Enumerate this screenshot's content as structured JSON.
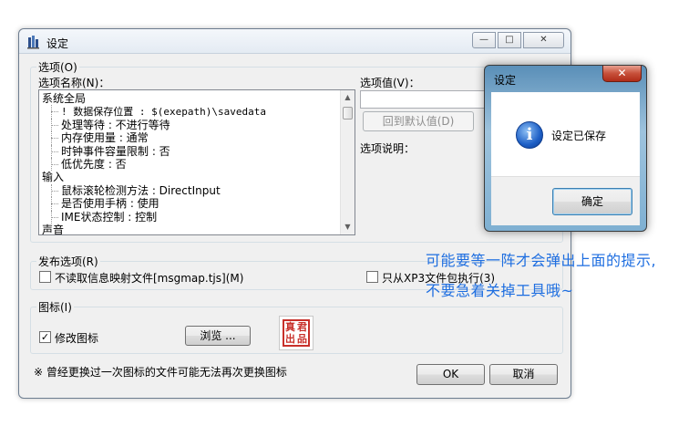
{
  "window": {
    "title": "设定",
    "controls": {
      "minimize": "—",
      "maximize": "□",
      "close": "✕"
    }
  },
  "options_group": {
    "label": "选项(O)",
    "name_label": "选项名称(N)：",
    "value_label": "选项值(V)：",
    "reset_button": "回到默认值(D)",
    "desc_label": "选项说明：",
    "tree": [
      {
        "type": "category",
        "text": "系统全局"
      },
      {
        "type": "child",
        "text": "! 数据保存位置 : $(exepath)\\savedata",
        "mono": true
      },
      {
        "type": "child",
        "text": "处理等待 : 不进行等待"
      },
      {
        "type": "child",
        "text": "内存使用量 : 通常"
      },
      {
        "type": "child",
        "text": "时钟事件容量限制 : 否"
      },
      {
        "type": "child",
        "text": "低优先度 : 否"
      },
      {
        "type": "category",
        "text": "输入"
      },
      {
        "type": "child",
        "text": "鼠标滚轮检测方法 : DirectInput"
      },
      {
        "type": "child",
        "text": "是否使用手柄 : 使用"
      },
      {
        "type": "child",
        "text": "IME状态控制 : 控制"
      },
      {
        "type": "category",
        "text": "声音"
      }
    ]
  },
  "publish_group": {
    "label": "发布选项(R)",
    "no_map_checkbox": "不读取信息映射文件[msgmap.tjs](M)",
    "xp3_only_checkbox": "只从XP3文件包执行(3)"
  },
  "icon_group": {
    "label": "图标(I)",
    "modify_icon_checkbox": "修改图标",
    "browse_button": "浏览 ...",
    "icon_chars": [
      "真",
      "君",
      "出",
      "品"
    ]
  },
  "footer": {
    "note": "※ 曾经更换过一次图标的文件可能无法再次更换图标",
    "ok_button": "OK",
    "cancel_button": "取消"
  },
  "message_box": {
    "title": "设定",
    "close": "✕",
    "message": "设定已保存",
    "ok_button": "确定"
  },
  "annotation": {
    "line1": "可能要等一阵才会弹出上面的提示,",
    "line2": "不要急着关掉工具哦~"
  },
  "colors": {
    "annotation_text": "#1e6ee0",
    "icon_stamp": "#c8302a"
  }
}
